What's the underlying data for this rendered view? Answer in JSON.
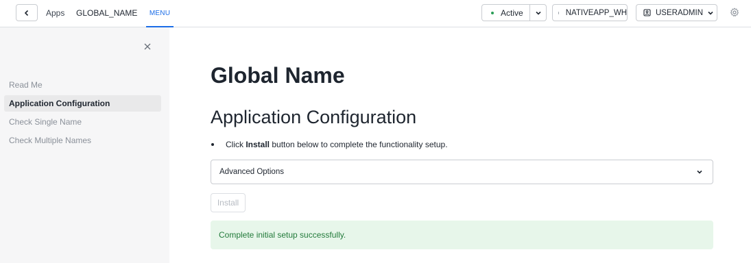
{
  "topbar": {
    "back_icon": "chevron-left-icon",
    "crumb_apps": "Apps",
    "crumb_app": "GLOBAL_NAME",
    "menu_tab": "MENU",
    "status": {
      "label": "Active",
      "dot_color": "#2a9d57"
    },
    "warehouse": {
      "label": "NATIVEAPP_WH",
      "dot_color": "#9aa0a8"
    },
    "role": {
      "label": "USERADMIN",
      "icon": "user-badge-icon"
    },
    "settings_icon": "gear-icon",
    "accent_color": "#1a6ce7"
  },
  "sidebar": {
    "close_icon": "close-icon",
    "items": [
      {
        "label": "Read Me",
        "active": false
      },
      {
        "label": "Application Configuration",
        "active": true
      },
      {
        "label": "Check Single Name",
        "active": false
      },
      {
        "label": "Check Multiple Names",
        "active": false
      }
    ]
  },
  "main": {
    "title": "Global Name",
    "subtitle": "Application Configuration",
    "instruction": {
      "prefix": "Click ",
      "bold": "Install",
      "suffix": " button below to complete the functionality setup."
    },
    "advanced_options": "Advanced Options",
    "install_button": "Install",
    "install_disabled": true,
    "success_message": "Complete initial setup successfully.",
    "success_color": "#227a3a"
  }
}
